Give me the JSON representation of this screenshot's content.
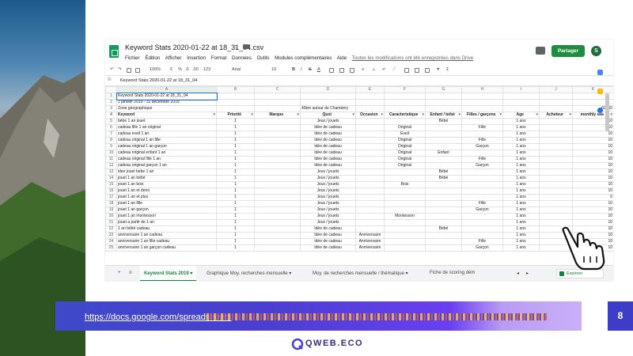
{
  "sheet": {
    "title": "Keyword Stats 2020-01-22 at 18_31_04.csv",
    "menu": [
      "Fichier",
      "Édition",
      "Afficher",
      "Insertion",
      "Format",
      "Données",
      "Outils",
      "Modules complémentaires",
      "Aide"
    ],
    "autosave": "Toutes les modifications ont été enregistrées dans Drive",
    "share_label": "Partager",
    "avatar_letter": "S",
    "toolbar": {
      "zoom": "100%",
      "currency": "€",
      "percent": "%",
      "dec0": ".0",
      "dec00": ".00",
      "format": "123",
      "font": "Arial",
      "size": "10"
    },
    "formula_value": "Keyword Stats 2020-01-22 at 18_31_04",
    "col_letters": [
      "A",
      "B",
      "C",
      "D",
      "E",
      "F",
      "G",
      "H",
      "I",
      "J",
      "K"
    ],
    "info_rows": [
      {
        "n": "1",
        "a": "Keyword Stats 2020-01-22 at 18_31_04"
      },
      {
        "n": "2",
        "a": "1 janvier 2019 - 31 décembre 2019"
      },
      {
        "n": "3",
        "a": "Zone géographique",
        "c": "40km autour de Chambéry",
        "k": "60960"
      }
    ],
    "headers": [
      "Keyword",
      "Priorité",
      "Marque",
      "Quoi",
      "Occasion",
      "Caracteristique",
      "Enfant / bébé",
      "Filles / garçons",
      "Age",
      "Acheteur",
      "monthly sea"
    ],
    "rows": [
      {
        "n": "5",
        "kw": "bébé 1 an jouet",
        "p": "1",
        "q": "Jeux / jouets",
        "o": "",
        "c": "",
        "e": "Bébé",
        "f": "",
        "a": "1 ans",
        "v": "10"
      },
      {
        "n": "6",
        "kw": "cadeau fille 1 an original",
        "p": "1",
        "q": "Idée de cadeau",
        "o": "",
        "c": "Original",
        "e": "",
        "f": "Fille",
        "a": "1 ans",
        "v": "10"
      },
      {
        "n": "7",
        "kw": "cadeau eveil 1 an",
        "p": "1",
        "q": "Idée de cadeau",
        "o": "",
        "c": "Éveil",
        "e": "",
        "f": "",
        "a": "1 ans",
        "v": "10"
      },
      {
        "n": "8",
        "kw": "cadeau original 1 an fille",
        "p": "1",
        "q": "Idée de cadeau",
        "o": "",
        "c": "Original",
        "e": "",
        "f": "Fille",
        "a": "1 ans",
        "v": "10"
      },
      {
        "n": "9",
        "kw": "cadeau original 1 an garçon",
        "p": "1",
        "q": "Idée de cadeau",
        "o": "",
        "c": "Original",
        "e": "",
        "f": "Garçon",
        "a": "1 ans",
        "v": "10"
      },
      {
        "n": "10",
        "kw": "cadeau original enfant 1 an",
        "p": "1",
        "q": "Idée de cadeau",
        "o": "",
        "c": "Original",
        "e": "Enfant",
        "f": "",
        "a": "1 ans",
        "v": "10"
      },
      {
        "n": "11",
        "kw": "cadeau original fille 1 an",
        "p": "1",
        "q": "Idée de cadeau",
        "o": "",
        "c": "Original",
        "e": "",
        "f": "Fille",
        "a": "1 ans",
        "v": "10"
      },
      {
        "n": "12",
        "kw": "cadeau original garçon 1 an",
        "p": "1",
        "q": "Idée de cadeau",
        "o": "",
        "c": "Original",
        "e": "",
        "f": "Garçon",
        "a": "1 ans",
        "v": "10"
      },
      {
        "n": "13",
        "kw": "idee jouet bebe 1 an",
        "p": "1",
        "q": "Jeux / jouets",
        "o": "",
        "c": "",
        "e": "Bébé",
        "f": "",
        "a": "1 ans",
        "v": "10"
      },
      {
        "n": "14",
        "kw": "jouet 1 an bébé",
        "p": "1",
        "q": "Jeux / jouets",
        "o": "",
        "c": "",
        "e": "Bébé",
        "f": "",
        "a": "1 ans",
        "v": "10"
      },
      {
        "n": "15",
        "kw": "jouet 1 an bois",
        "p": "1",
        "q": "Jeux / jouets",
        "o": "",
        "c": "Bois",
        "e": "",
        "f": "",
        "a": "1 ans",
        "v": "10"
      },
      {
        "n": "16",
        "kw": "jouet 1 an et demi",
        "p": "1",
        "q": "Jeux / jouets",
        "o": "",
        "c": "",
        "e": "",
        "f": "",
        "a": "1 ans",
        "v": "10"
      },
      {
        "n": "17",
        "kw": "jouet 1 an et plus",
        "p": "1",
        "q": "Jeux / jouets",
        "o": "",
        "c": "",
        "e": "",
        "f": "",
        "a": "1 ans",
        "v": "0"
      },
      {
        "n": "18",
        "kw": "jouet 1 an fille",
        "p": "1",
        "q": "Jeux / jouets",
        "o": "",
        "c": "",
        "e": "",
        "f": "Fille",
        "a": "1 ans",
        "v": "10"
      },
      {
        "n": "19",
        "kw": "jouet 1 an garçon",
        "p": "1",
        "q": "Jeux / jouets",
        "o": "",
        "c": "",
        "e": "",
        "f": "Garçon",
        "a": "1 ans",
        "v": "10"
      },
      {
        "n": "20",
        "kw": "jouet 1 an montessori",
        "p": "1",
        "q": "Jeux / jouets",
        "o": "",
        "c": "Montessori",
        "e": "",
        "f": "",
        "a": "1 ans",
        "v": "10"
      },
      {
        "n": "21",
        "kw": "jouet a partir de 1 an",
        "p": "1",
        "q": "Jeux / jouets",
        "o": "",
        "c": "",
        "e": "",
        "f": "",
        "a": "1 ans",
        "v": "10"
      },
      {
        "n": "22",
        "kw": "1 an bébé cadeau",
        "p": "1",
        "q": "Idée de cadeau",
        "o": "",
        "c": "",
        "e": "Bébé",
        "f": "",
        "a": "1 ans",
        "v": "10"
      },
      {
        "n": "23",
        "kw": "anniversaire 1 an cadeau",
        "p": "1",
        "q": "Idée de cadeau",
        "o": "Anniversaire",
        "c": "",
        "e": "",
        "f": "",
        "a": "1 ans",
        "v": "10"
      },
      {
        "n": "24",
        "kw": "anniversaire 1 an fille cadeau",
        "p": "1",
        "q": "Idée de cadeau",
        "o": "Anniversaire",
        "c": "",
        "e": "",
        "f": "Fille",
        "a": "1 ans",
        "v": "10"
      },
      {
        "n": "25",
        "kw": "anniversaire 1 an garçon cadeau",
        "p": "1",
        "q": "Idée de cadeau",
        "o": "Anniversaire",
        "c": "",
        "e": "",
        "f": "Garçon",
        "a": "1 ans",
        "v": "10"
      }
    ],
    "tabs": [
      "Keyword Stats 2019",
      "Graphique Moy. recherches mensuelle",
      "Moy. de recherches mensuelle / thématique",
      "Fiche de scoring dém"
    ],
    "explore_label": "Explorer"
  },
  "slide": {
    "url": "https://docs.google.com/spreadsheets",
    "page_number": "8",
    "brand": "QWEB.ECO"
  },
  "colors": {
    "accent": "#4a3fd0",
    "sheets_green": "#0f9d58",
    "share_green": "#1e8e3e"
  }
}
